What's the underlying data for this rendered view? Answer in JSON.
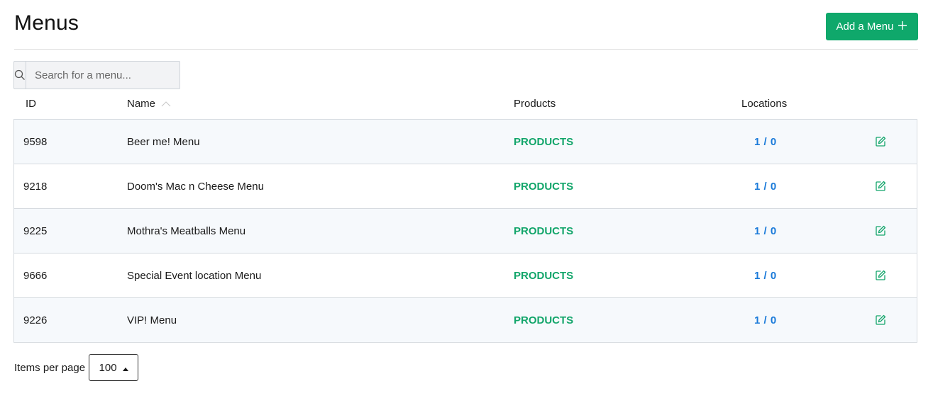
{
  "page": {
    "title": "Menus"
  },
  "toolbar": {
    "add_label": "Add a Menu",
    "add_icon": "plus-icon"
  },
  "search": {
    "placeholder": "Search for a menu...",
    "value": "",
    "icon": "search-icon"
  },
  "table": {
    "columns": {
      "id": "ID",
      "name": "Name",
      "products": "Products",
      "locations": "Locations"
    },
    "sort": {
      "column": "Name",
      "direction": "ascending"
    },
    "rows": [
      {
        "id": "9598",
        "name": "Beer me! Menu",
        "products": "PRODUCTS",
        "locations": "1 / 0"
      },
      {
        "id": "9218",
        "name": "Doom's Mac n Cheese Menu",
        "products": "PRODUCTS",
        "locations": "1 / 0"
      },
      {
        "id": "9225",
        "name": "Mothra's Meatballs Menu",
        "products": "PRODUCTS",
        "locations": "1 / 0"
      },
      {
        "id": "9666",
        "name": "Special Event location Menu",
        "products": "PRODUCTS",
        "locations": "1 / 0"
      },
      {
        "id": "9226",
        "name": "VIP! Menu",
        "products": "PRODUCTS",
        "locations": "1 / 0"
      }
    ]
  },
  "pagination": {
    "label": "Items per page",
    "value": "100"
  },
  "colors": {
    "primary": "#0fa86b",
    "products_link": "#12a56a",
    "locations_link": "#1a7ad9",
    "row_alt": "#f6f9fc"
  }
}
